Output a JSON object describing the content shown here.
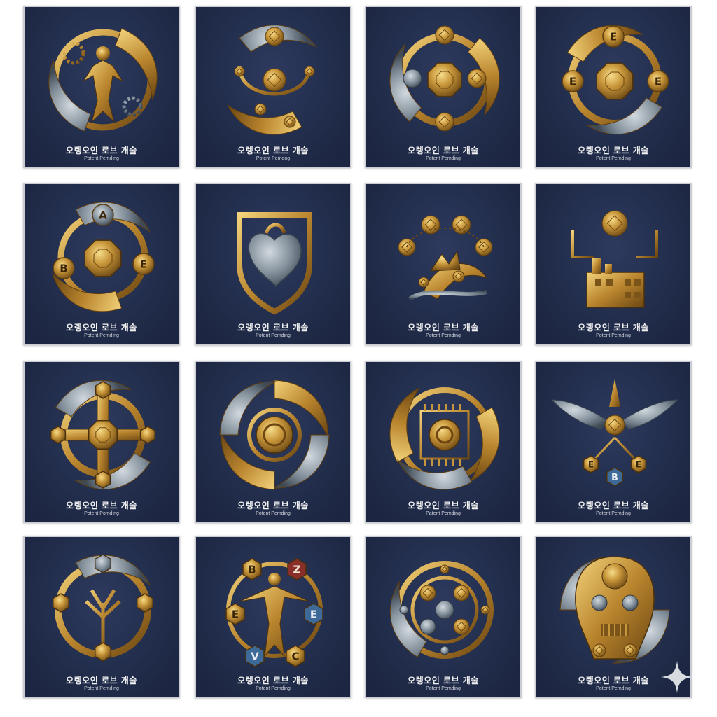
{
  "cards": [
    {
      "title": "오렝오인 로브 개술",
      "subtitle": "Potent Pemding",
      "emblem": "humanoid-gear-ring-icon"
    },
    {
      "title": "오렝오인 로브 개술",
      "subtitle": "Potent Pemdog",
      "emblem": "drone-orb-icon"
    },
    {
      "title": "오렝오인 로브 개술",
      "subtitle": "Potent Pemding",
      "emblem": "orbiting-spheres-icon"
    },
    {
      "title": "오렝오인 로브 개술",
      "subtitle": "Potent Pemding",
      "emblem": "e-badge-ring-icon",
      "letters": [
        "E",
        "E",
        "E"
      ]
    },
    {
      "title": "오렝오인 로브 개술",
      "subtitle": "Potent Pemding",
      "emblem": "abe-ring-icon",
      "letters": [
        "A",
        "B",
        "E"
      ]
    },
    {
      "title": "오렝오인 로브 개술",
      "subtitle": "Potent Pemding",
      "emblem": "mechanical-heart-shield-icon"
    },
    {
      "title": "오렝오인 로브 개술",
      "subtitle": "Potent Pemding",
      "emblem": "leaf-swirl-orbs-icon"
    },
    {
      "title": "오렝오인 로브 개술",
      "subtitle": "Potent Pemding",
      "emblem": "drone-factory-icon"
    },
    {
      "title": "오렝오인 로브 개술",
      "subtitle": "Potent Pomding",
      "emblem": "compass-cross-icon"
    },
    {
      "title": "오렝오인 로브 개술",
      "subtitle": "Potent Pemding",
      "emblem": "swirl-core-icon"
    },
    {
      "title": "오렝오인 로브 개술",
      "subtitle": "Patent Pemding",
      "emblem": "circuit-swirl-icon"
    },
    {
      "title": "오렝오인 로브 개술",
      "subtitle": "Potent Pemding",
      "emblem": "winged-beb-icon",
      "letters": [
        "E",
        "B",
        "E"
      ]
    },
    {
      "title": "오렝오인 로브 개술",
      "subtitle": "Potent Pemding",
      "emblem": "tree-circuit-ring-icon"
    },
    {
      "title": "오렝오인 로브 개술",
      "subtitle": "Potent Pemding",
      "emblem": "figure-hexagons-icon",
      "letters": [
        "B",
        "Z",
        "E",
        "E",
        "V",
        "C"
      ]
    },
    {
      "title": "오렝오인 로브 개술",
      "subtitle": "Potent Pemding",
      "emblem": "atom-spheres-icon"
    },
    {
      "title": "오렝오인 로브 개술",
      "subtitle": "Potent Pemding",
      "emblem": "robot-mask-icon"
    }
  ],
  "colors": {
    "card_bg": "#1f2a47",
    "gold": "#c8963a",
    "gold_light": "#e8c66a",
    "gold_dark": "#7a5418",
    "steel": "#8e9aa6",
    "blue_gem": "#3d6a98",
    "red_gem": "#8a2e2a"
  }
}
